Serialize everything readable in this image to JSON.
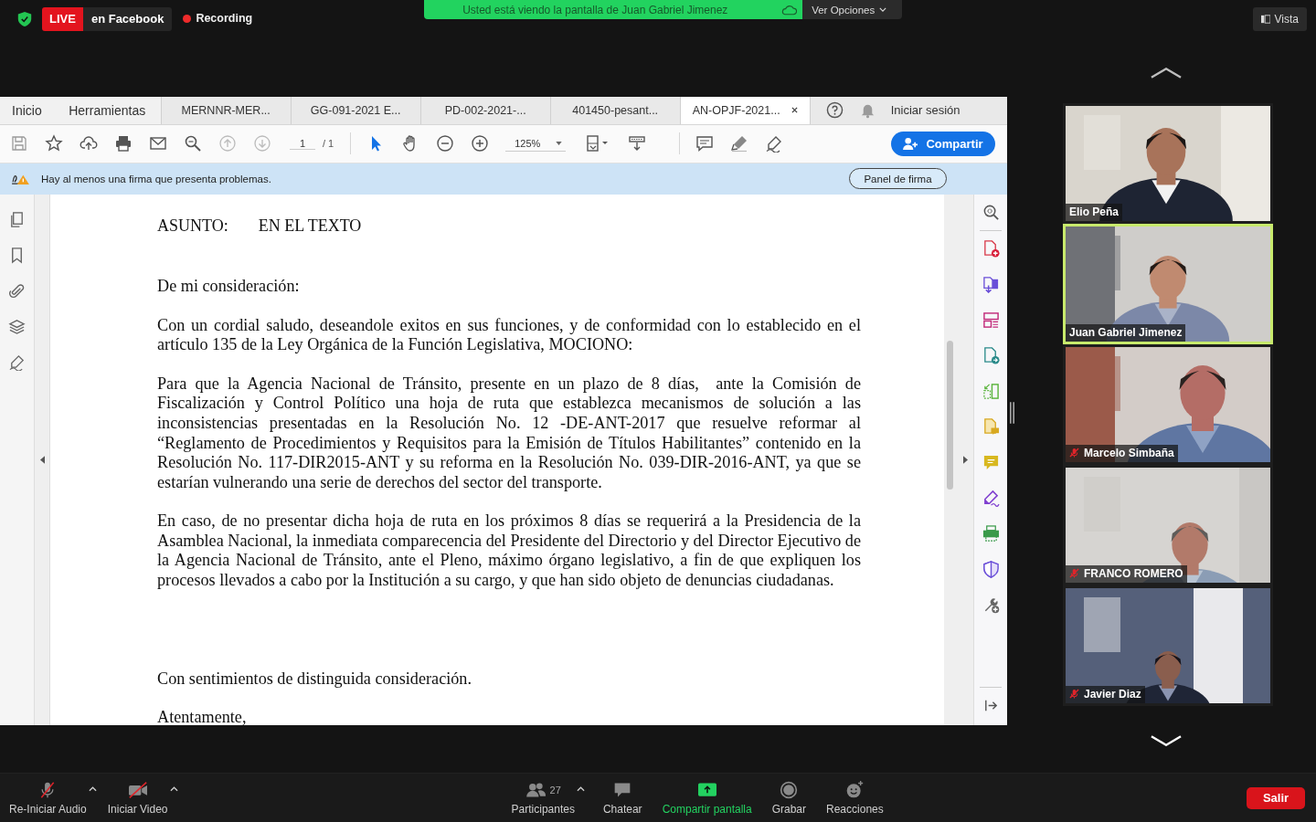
{
  "top_bar": {
    "live_badge": "LIVE",
    "live_platform": "en Facebook",
    "recording": "Recording",
    "share_banner": "Usted está viendo la pantalla de Juan Gabriel Jimenez",
    "options_button": "Ver Opciones",
    "view_button": "Vista"
  },
  "acrobat": {
    "tabs": [
      {
        "label": "Inicio",
        "kind": "nav",
        "selected": false
      },
      {
        "label": "Herramientas",
        "kind": "nav",
        "selected": false
      },
      {
        "label": "MERNNR-MER...",
        "kind": "document",
        "selected": false
      },
      {
        "label": "GG-091-2021 E...",
        "kind": "document",
        "selected": false
      },
      {
        "label": "PD-002-2021-...",
        "kind": "document",
        "selected": false
      },
      {
        "label": "401450-pesant...",
        "kind": "document",
        "selected": false
      },
      {
        "label": "AN-OPJF-2021...",
        "kind": "document",
        "selected": true
      }
    ],
    "sign_in": "Iniciar sesión",
    "toolbar": {
      "page": "1",
      "page_total": "/ 1",
      "zoom": "125%",
      "share_button": "Compartir"
    },
    "signature_bar": {
      "message": "Hay al menos una firma que presenta problemas.",
      "button": "Panel de firma"
    },
    "document": {
      "subject_label": "ASUNTO:",
      "subject_value": "EN EL TEXTO",
      "paragraphs": [
        {
          "kind": "salutation",
          "text": "De mi consideración:"
        },
        {
          "kind": "body",
          "text": "Con un cordial saludo, deseandole exitos en sus funciones, y de conformidad con lo establecido en el artículo 135 de la Ley Orgánica de la Función Legislativa, MOCIONO:"
        },
        {
          "kind": "body",
          "text": "Para que la Agencia Nacional de Tránsito, presente en un plazo de 8 días,  ante la Comisión de Fiscalización y Control Político una hoja de ruta que establezca mecanismos de solución a las inconsistencias presentadas en la Resolución No. 12 -DE-ANT-2017 que resuelve reformar al “Reglamento de Procedimientos y Requisitos para la Emisión de Títulos Habilitantes” contenido en la Resolución No. 117-DIR2015-ANT y su reforma en la Resolución No. 039-DIR-2016-ANT, ya que se estarían vulnerando una serie de derechos del sector del transporte."
        },
        {
          "kind": "body",
          "text": "En caso, de no presentar dicha hoja de ruta en los próximos 8 días se requerirá a la Presidencia de la Asamblea Nacional, la inmediata comparecencia del Presidente del Directorio y del Director Ejecutivo de la Agencia Nacional de Tránsito, ante el Pleno, máximo órgano legislativo, a fin de que expliquen los procesos llevados a cabo por la Institución a su cargo, y que han sido objeto de denuncias ciudadanas."
        },
        {
          "kind": "closing",
          "text": "Con sentimientos de distinguida consideración."
        },
        {
          "kind": "signoff",
          "text": "Atentamente,"
        }
      ]
    }
  },
  "participants": [
    {
      "name": "Elio Peña",
      "muted": false,
      "speaking": false
    },
    {
      "name": "Juan Gabriel Jimenez",
      "muted": false,
      "speaking": true
    },
    {
      "name": "Marcelo Simbaña",
      "muted": true,
      "speaking": false
    },
    {
      "name": "FRANCO ROMERO",
      "muted": true,
      "speaking": false
    },
    {
      "name": "Javier Diaz",
      "muted": true,
      "speaking": false
    }
  ],
  "bottom_bar": {
    "controls": [
      {
        "kind": "audio",
        "label": "Re-Iniciar Audio"
      },
      {
        "kind": "video",
        "label": "Iniciar Video"
      },
      {
        "kind": "participants",
        "label": "Participantes",
        "count": "27"
      },
      {
        "kind": "chat",
        "label": "Chatear"
      },
      {
        "kind": "share",
        "label": "Compartir pantalla"
      },
      {
        "kind": "record",
        "label": "Grabar"
      },
      {
        "kind": "reactions",
        "label": "Reacciones"
      }
    ],
    "leave_button": "Salir"
  }
}
